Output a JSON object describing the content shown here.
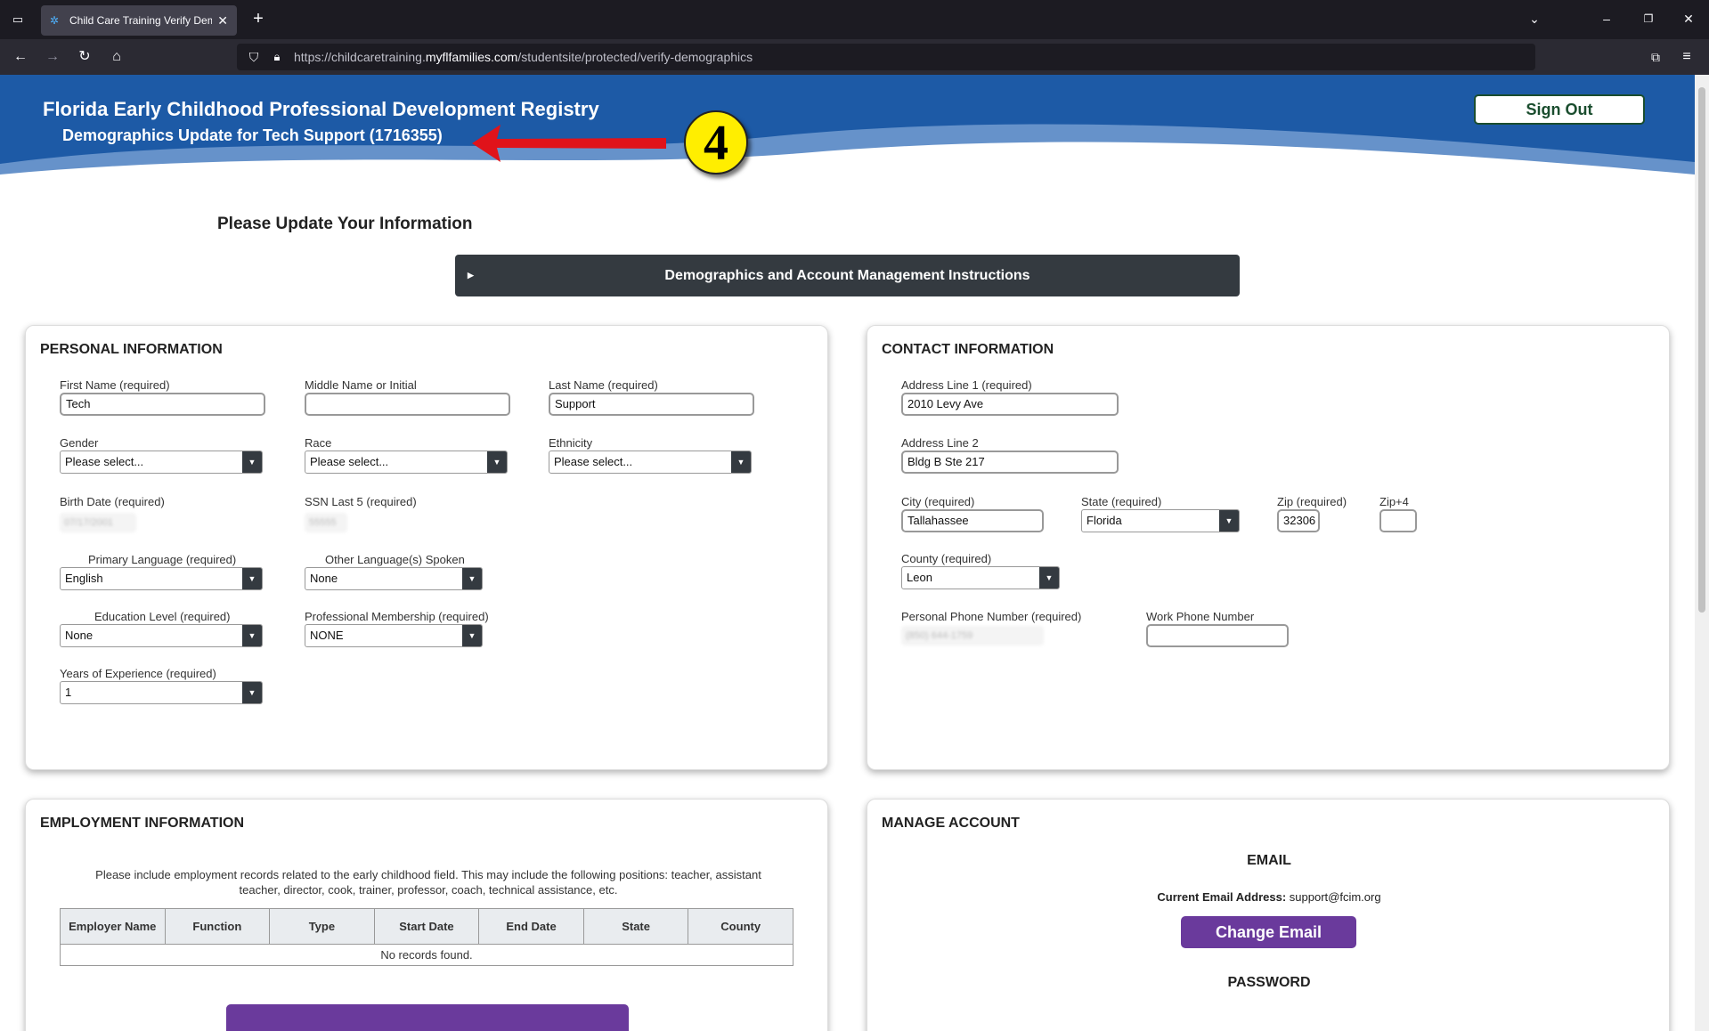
{
  "browser": {
    "tab_title": "Child Care Training Verify Demo",
    "url_prefix": "https://childcaretraining.",
    "url_domain": "myflfamilies.com",
    "url_path": "/studentsite/protected/verify-demographics"
  },
  "banner": {
    "title": "Florida Early Childhood Professional Development Registry",
    "subtitle": "Demographics Update for Tech Support (1716355)",
    "sign_out": "Sign Out",
    "step_badge": "4",
    "accent_yellow": "#ffee00",
    "arrow_red": "#e0131a"
  },
  "main": {
    "heading": "Please Update Your Information",
    "instructions_label": "Demographics and Account Management Instructions"
  },
  "personal": {
    "title": "PERSONAL INFORMATION",
    "first_name_label": "First Name (required)",
    "first_name_value": "Tech",
    "middle_name_label": "Middle Name or Initial",
    "middle_name_value": "",
    "last_name_label": "Last Name (required)",
    "last_name_value": "Support",
    "gender_label": "Gender",
    "gender_value": "Please select...",
    "race_label": "Race",
    "race_value": "Please select...",
    "ethnicity_label": "Ethnicity",
    "ethnicity_value": "Please select...",
    "birth_date_label": "Birth Date (required)",
    "birth_date_value": "07/17/2001",
    "ssn_label": "SSN Last 5 (required)",
    "ssn_value": "55555",
    "primary_language_label": "Primary Language (required)",
    "primary_language_value": "English",
    "other_language_label": "Other Language(s) Spoken",
    "other_language_value": "None",
    "education_label": "Education Level (required)",
    "education_value": "None",
    "membership_label": "Professional Membership (required)",
    "membership_value": "NONE",
    "experience_label": "Years of Experience (required)",
    "experience_value": "1"
  },
  "contact": {
    "title": "CONTACT INFORMATION",
    "address1_label": "Address Line 1 (required)",
    "address1_value": "2010 Levy Ave",
    "address2_label": "Address Line 2",
    "address2_value": "Bldg B Ste 217",
    "city_label": "City (required)",
    "city_value": "Tallahassee",
    "state_label": "State (required)",
    "state_value": "Florida",
    "zip_label": "Zip (required)",
    "zip_value": "32306",
    "zip4_label": "Zip+4",
    "zip4_value": "",
    "county_label": "County (required)",
    "county_value": "Leon",
    "personal_phone_label": "Personal Phone Number (required)",
    "personal_phone_value": "(850) 644-1759",
    "work_phone_label": "Work Phone Number",
    "work_phone_value": ""
  },
  "employment": {
    "title": "EMPLOYMENT INFORMATION",
    "note": "Please include employment records related to the early childhood field. This may include the following positions: teacher, assistant teacher, director, cook, trainer, professor, coach, technical assistance, etc.",
    "columns": [
      "Employer Name",
      "Function",
      "Type",
      "Start Date",
      "End Date",
      "State",
      "County"
    ],
    "empty_text": "No records found."
  },
  "account": {
    "title": "MANAGE ACCOUNT",
    "email_heading": "EMAIL",
    "current_email_label": "Current Email Address:",
    "current_email_value": "support@fcim.org",
    "change_email": "Change Email",
    "password_heading": "PASSWORD"
  }
}
